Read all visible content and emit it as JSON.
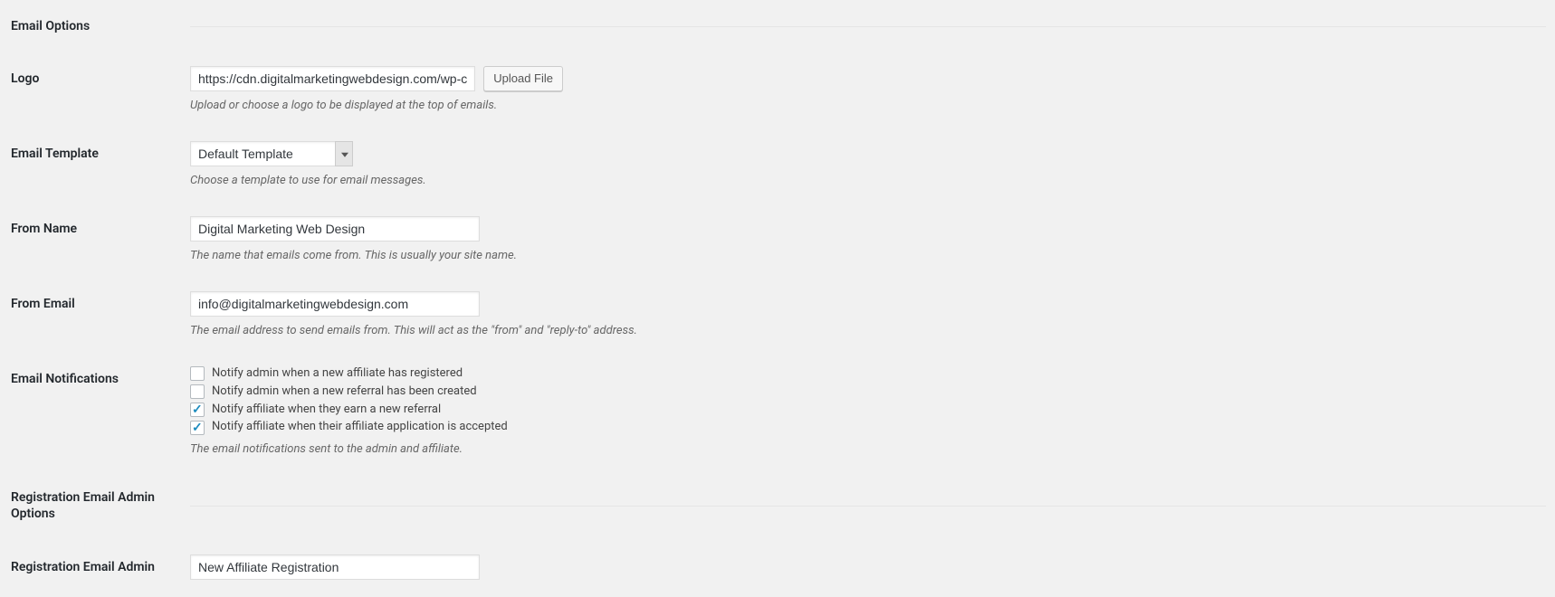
{
  "sections": {
    "email_options": {
      "heading": "Email Options"
    },
    "registration_admin_options": {
      "heading": "Registration Email Admin Options"
    }
  },
  "fields": {
    "logo": {
      "label": "Logo",
      "value": "https://cdn.digitalmarketingwebdesign.com/wp-content",
      "button": "Upload File",
      "description": "Upload or choose a logo to be displayed at the top of emails."
    },
    "email_template": {
      "label": "Email Template",
      "selected": "Default Template",
      "description": "Choose a template to use for email messages."
    },
    "from_name": {
      "label": "From Name",
      "value": "Digital Marketing Web Design",
      "description": "The name that emails come from. This is usually your site name."
    },
    "from_email": {
      "label": "From Email",
      "value": "info@digitalmarketingwebdesign.com",
      "description": "The email address to send emails from. This will act as the \"from\" and \"reply-to\" address."
    },
    "email_notifications": {
      "label": "Email Notifications",
      "options": [
        {
          "label": "Notify admin when a new affiliate has registered",
          "checked": false
        },
        {
          "label": "Notify admin when a new referral has been created",
          "checked": false
        },
        {
          "label": "Notify affiliate when they earn a new referral",
          "checked": true
        },
        {
          "label": "Notify affiliate when their affiliate application is accepted",
          "checked": true
        }
      ],
      "description": "The email notifications sent to the admin and affiliate."
    },
    "registration_email_admin": {
      "label": "Registration Email Admin",
      "value": "New Affiliate Registration"
    }
  }
}
